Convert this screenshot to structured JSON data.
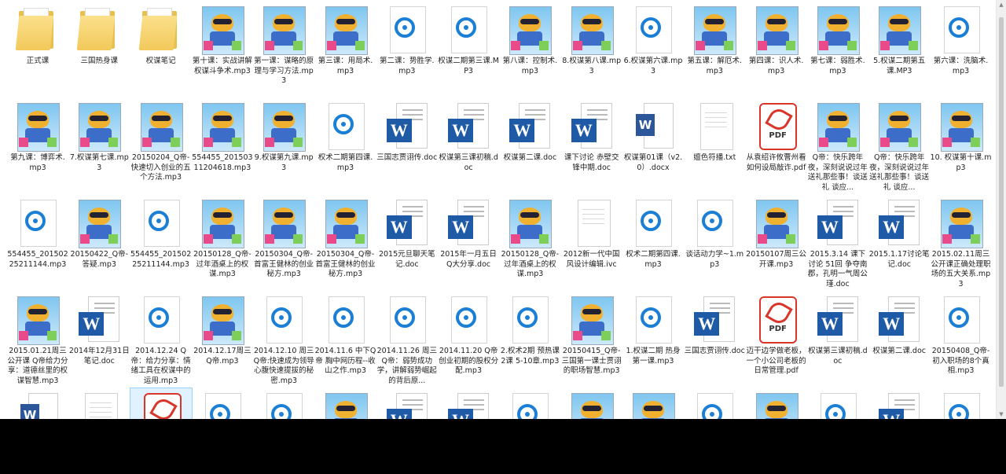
{
  "files": [
    {
      "label": "正式课",
      "type": "folder"
    },
    {
      "label": "三国热身课",
      "type": "folder"
    },
    {
      "label": "权谋笔记",
      "type": "folder"
    },
    {
      "label": "第十课：实战讲解权谋斗争术.mp3",
      "type": "mascot"
    },
    {
      "label": "第一课：谋略的原理与学习方法.mp3",
      "type": "mascot"
    },
    {
      "label": "第三课：用局术.mp3",
      "type": "mascot"
    },
    {
      "label": "第二课：势胜学.mp3",
      "type": "audio"
    },
    {
      "label": "权谋二期第三课.MP3",
      "type": "audio"
    },
    {
      "label": "第八课：控制术.mp3",
      "type": "mascot"
    },
    {
      "label": "8.权谋第八课.mp3",
      "type": "mascot"
    },
    {
      "label": "6.权谋第六课.mp3",
      "type": "audio"
    },
    {
      "label": "第五课：解厄术.mp3",
      "type": "mascot"
    },
    {
      "label": "第四课：识人术.mp3",
      "type": "mascot"
    },
    {
      "label": "第七课：弱胜术.mp3",
      "type": "mascot"
    },
    {
      "label": "5.权谋二期第五课.MP3",
      "type": "mascot"
    },
    {
      "label": "第六课：洗脑术.mp3",
      "type": "audio"
    },
    {
      "label": "第九课：博弈术.mp3",
      "type": "mascot"
    },
    {
      "label": "7.权谋第七课.mp3",
      "type": "mascot"
    },
    {
      "label": "20150204_Q帝-快速切入创业的五个方法.mp3",
      "type": "mascot"
    },
    {
      "label": "554455_20150311204618.mp3",
      "type": "mascot"
    },
    {
      "label": "9.权谋第九课.mp3",
      "type": "mascot"
    },
    {
      "label": "权术二期第四课.mp3",
      "type": "audio"
    },
    {
      "label": "三国志贾诩传.doc",
      "type": "word"
    },
    {
      "label": "权谋第三课初稿.doc",
      "type": "word"
    },
    {
      "label": "权谋第二课.doc",
      "type": "word"
    },
    {
      "label": "课下讨论 赤壁交锋中期.doc",
      "type": "word"
    },
    {
      "label": "权谋第01课（v2.0）.docx",
      "type": "wordx"
    },
    {
      "label": "嬗色符播.txt",
      "type": "blank"
    },
    {
      "label": "从袁绍许攸曹州看如何设局敲诈.pdf",
      "type": "pdf"
    },
    {
      "label": "Q帝：快乐跨年夜，深刻说说过年送礼那些事！谈送礼 谈应...",
      "type": "mascot"
    },
    {
      "label": "Q帝：快乐跨年夜，深刻说说过年送礼那些事！谈送礼 谈应...",
      "type": "mascot"
    },
    {
      "label": "10. 权谋第十课.mp3",
      "type": "mascot"
    },
    {
      "label": "554455_20150225211144.mp3",
      "type": "audio"
    },
    {
      "label": "20150422_Q帝-答疑.mp3",
      "type": "mascot"
    },
    {
      "label": "554455_20150225211144.mp3",
      "type": "audio"
    },
    {
      "label": "20150128_Q帝-过年酒桌上的权谋.mp3",
      "type": "mascot"
    },
    {
      "label": "20150304_Q帝-首富王健林的创业秘方.mp3",
      "type": "mascot"
    },
    {
      "label": "20150304_Q帝-首富王健林的创业秘方.mp3",
      "type": "mascot"
    },
    {
      "label": "2015元旦聊天笔记.doc",
      "type": "word"
    },
    {
      "label": "2015年一月五日Q大分享.doc",
      "type": "word"
    },
    {
      "label": "20150128_Q帝-过年酒桌上的权谋.mp3",
      "type": "mascot"
    },
    {
      "label": "2012新一代中国风设计编辑.ivc",
      "type": "blank"
    },
    {
      "label": "权术二期第四课.mp3",
      "type": "audio"
    },
    {
      "label": "谈话动力学~1.mp3",
      "type": "audio"
    },
    {
      "label": "20150107周三公开课.mp3",
      "type": "mascot"
    },
    {
      "label": "2015.3.14 课下讨论 51回 争夺南郡，孔明一气周公瑾.doc",
      "type": "word"
    },
    {
      "label": "2015.1.17讨论笔记.doc",
      "type": "word"
    },
    {
      "label": "2015.02.11周三公开课正确处理职场的五大关系.mp3",
      "type": "mascot"
    },
    {
      "label": "2015.01.21周三公开课 Q帝给力分享：道德丝里的权谋智慧.mp3",
      "type": "mascot"
    },
    {
      "label": "2014年12月31日笔记.doc",
      "type": "word"
    },
    {
      "label": "2014.12.24 Q帝：给力分享：情绪工具在权谋中的运用.mp3",
      "type": "audio"
    },
    {
      "label": "2014.12.17周三Q帝.mp3",
      "type": "mascot"
    },
    {
      "label": "2014.12.10 周三 Q帝:快速成为领导心腹快速提拔的秘密.mp3",
      "type": "audio"
    },
    {
      "label": "2014.11.6 中下Q帝 胸中网历程--收山之作.mp3",
      "type": "audio"
    },
    {
      "label": "2014.11.26 周三 Q帝：弱势成功学，讲解弱势崛起的背后原...",
      "type": "audio"
    },
    {
      "label": "2014.11.20 Q帝创业初期的股权分配.mp3",
      "type": "audio"
    },
    {
      "label": "2.权术2期 预热课2课 5-10章.mp3",
      "type": "audio"
    },
    {
      "label": "20150415_Q帝-三国第一课士贾诩的职场智慧.mp3",
      "type": "mascot"
    },
    {
      "label": "1.权谋二期 热身第一课.mp3",
      "type": "audio"
    },
    {
      "label": "三国志贾诩传.doc",
      "type": "word"
    },
    {
      "label": "迈干边学做老板，一个小公司老板的日常管理.pdf",
      "type": "pdf"
    },
    {
      "label": "权谋第三课初稿.doc",
      "type": "word"
    },
    {
      "label": "权谋第二课.doc",
      "type": "word"
    },
    {
      "label": "20150408_Q帝-初入职场的8个真相.mp3",
      "type": "audio"
    },
    {
      "label": "",
      "type": "wordx"
    },
    {
      "label": "",
      "type": "blank"
    },
    {
      "label": "",
      "type": "pdf",
      "selected": true
    },
    {
      "label": "",
      "type": "audio"
    },
    {
      "label": "",
      "type": "audio"
    },
    {
      "label": "",
      "type": "mascot"
    },
    {
      "label": "",
      "type": "word"
    },
    {
      "label": "",
      "type": "word"
    },
    {
      "label": "",
      "type": "audio"
    },
    {
      "label": "",
      "type": "mascot"
    },
    {
      "label": "",
      "type": "mascot"
    },
    {
      "label": "",
      "type": "audio"
    },
    {
      "label": "",
      "type": "mascot"
    },
    {
      "label": "",
      "type": "audio"
    },
    {
      "label": "",
      "type": "word"
    },
    {
      "label": "",
      "type": "audio"
    }
  ],
  "pdf_text": "PDF",
  "word_letter": "W",
  "colors": {
    "word": "#1f5aa6",
    "audio": "#1c7fd6",
    "pdf": "#d9362b",
    "folder": "#f2c95a"
  }
}
